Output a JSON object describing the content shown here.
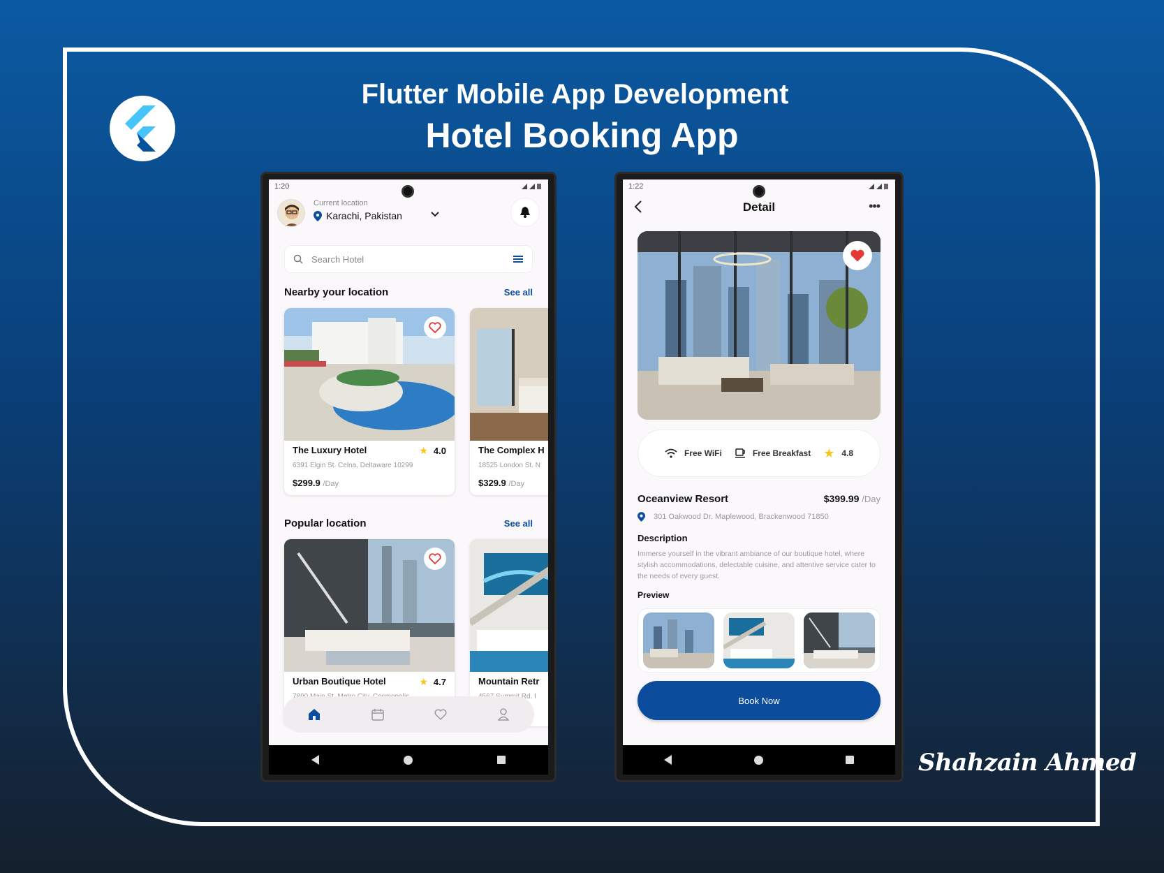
{
  "header": {
    "line1": "Flutter Mobile App Development",
    "line2": "Hotel Booking App"
  },
  "signature": "Shahzain Ahmed",
  "left_phone": {
    "status_time": "1:20",
    "current_location_label": "Current location",
    "city": "Karachi, Pakistan",
    "search_placeholder": "Search Hotel",
    "nearby": {
      "title": "Nearby your location",
      "see_all": "See all",
      "cards": [
        {
          "name": "The Luxury Hotel",
          "rating": "4.0",
          "address": "6391 Elgin St. Celna, Deltaware 10299",
          "price": "$299.9",
          "unit": "/Day"
        },
        {
          "name": "The Complex H",
          "address": "18525 London St. N",
          "price": "$329.9",
          "unit": "/Day"
        }
      ]
    },
    "popular": {
      "title": "Popular location",
      "see_all": "See all",
      "cards": [
        {
          "name": "Urban Boutique Hotel",
          "rating": "4.7",
          "address": "7890 Main St. Metro City, Cosmopolis"
        },
        {
          "name": "Mountain Retr",
          "address": "4567 Summit Rd. I"
        }
      ]
    },
    "bottom_nav": [
      "home-icon",
      "calendar-icon",
      "heart-icon",
      "profile-icon"
    ]
  },
  "right_phone": {
    "status_time": "1:22",
    "title": "Detail",
    "amenities": [
      {
        "icon": "wifi-icon",
        "label": "Free WiFi"
      },
      {
        "icon": "coffee-icon",
        "label": "Free Breakfast"
      },
      {
        "icon": "star-icon",
        "label": "4.8"
      }
    ],
    "hotel_name": "Oceanview Resort",
    "price": "$399.99",
    "unit": "/Day",
    "address": "301 Oakwood Dr. Maplewood, Brackenwood 71850",
    "description_title": "Description",
    "description": "Immerse yourself in the vibrant ambiance of our boutique hotel, where stylish accommodations, delectable cuisine, and attentive service cater to the needs of every guest.",
    "preview_title": "Preview",
    "book_button": "Book Now"
  },
  "colors": {
    "accent": "#0b4c9c",
    "heart": "#e53935",
    "star": "#f5c518"
  }
}
